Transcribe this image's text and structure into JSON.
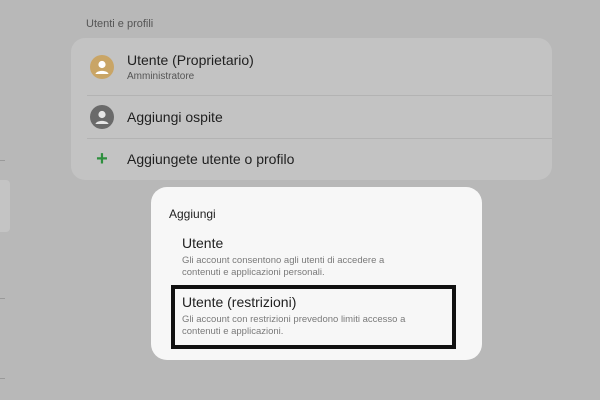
{
  "section": {
    "title": "Utenti e profili"
  },
  "users": {
    "owner": {
      "name": "Utente (Proprietario)",
      "role": "Amministratore",
      "icon": "person-icon",
      "color": "#c9a566"
    },
    "guest": {
      "label": "Aggiungi ospite",
      "icon": "person-icon",
      "color": "#6a6a6a"
    },
    "add": {
      "label": "Aggiungete utente o profilo",
      "icon": "plus-icon",
      "color": "#2e8f3e"
    }
  },
  "dialog": {
    "title": "Aggiungi",
    "options": [
      {
        "title": "Utente",
        "description": "Gli account consentono agli utenti di accedere a contenuti e applicazioni personali."
      },
      {
        "title": "Utente (restrizioni)",
        "description": "Gli account con restrizioni prevedono limiti accesso a contenuti e applicazioni."
      }
    ]
  }
}
